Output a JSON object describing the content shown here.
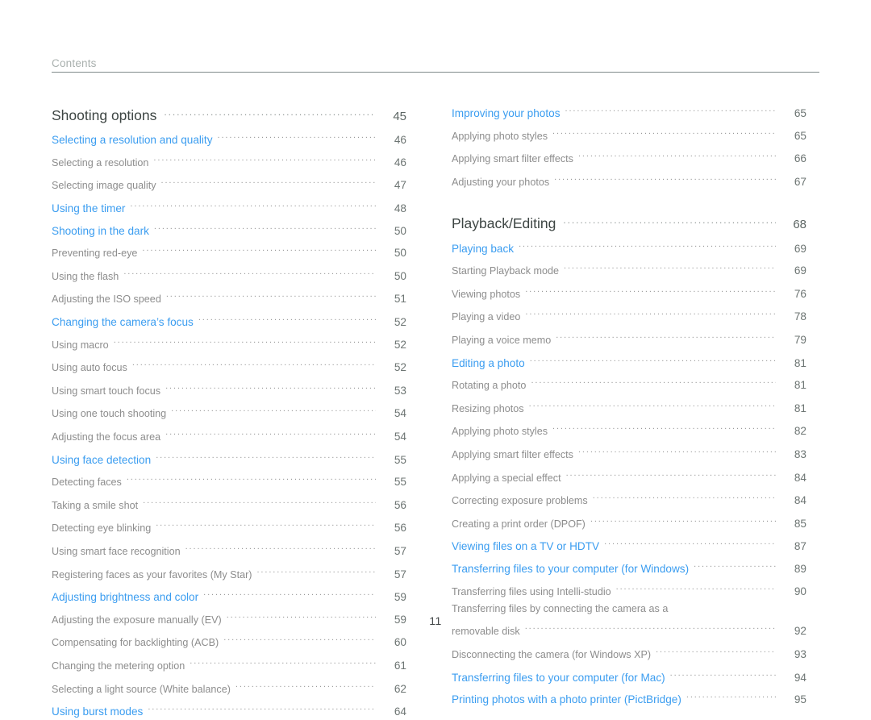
{
  "header": {
    "title": "Contents"
  },
  "colors": {
    "link_blue": "#3b9df0",
    "sub_gray": "#8d8d8d",
    "section_dark": "#3d4543",
    "header_gray": "#a9b0ae",
    "page_number": "#6d7573"
  },
  "footer": {
    "page_number": "11"
  },
  "left_column": [
    {
      "level": "section",
      "label": "Shooting options",
      "page": "45"
    },
    {
      "level": "1",
      "label": "Selecting a resolution and quality",
      "page": "46"
    },
    {
      "level": "2",
      "label": "Selecting a resolution",
      "page": "46"
    },
    {
      "level": "2",
      "label": "Selecting image quality",
      "page": "47"
    },
    {
      "level": "1",
      "label": "Using the timer",
      "page": "48"
    },
    {
      "level": "1",
      "label": "Shooting in the dark",
      "page": "50"
    },
    {
      "level": "2",
      "label": "Preventing red-eye",
      "page": "50"
    },
    {
      "level": "2",
      "label": "Using the flash",
      "page": "50"
    },
    {
      "level": "2",
      "label": "Adjusting the ISO speed",
      "page": "51"
    },
    {
      "level": "1",
      "label": "Changing the camera’s focus",
      "page": "52"
    },
    {
      "level": "2",
      "label": "Using macro",
      "page": "52"
    },
    {
      "level": "2",
      "label": "Using auto focus",
      "page": "52"
    },
    {
      "level": "2",
      "label": "Using smart touch focus",
      "page": "53"
    },
    {
      "level": "2",
      "label": "Using one touch shooting",
      "page": "54"
    },
    {
      "level": "2",
      "label": "Adjusting the focus area",
      "page": "54"
    },
    {
      "level": "1",
      "label": "Using face detection",
      "page": "55"
    },
    {
      "level": "2",
      "label": "Detecting faces",
      "page": "55"
    },
    {
      "level": "2",
      "label": "Taking a smile shot",
      "page": "56"
    },
    {
      "level": "2",
      "label": "Detecting eye blinking",
      "page": "56"
    },
    {
      "level": "2",
      "label": "Using smart face recognition",
      "page": "57"
    },
    {
      "level": "2",
      "label": "Registering faces as your favorites (My Star)",
      "page": "57"
    },
    {
      "level": "1",
      "label": "Adjusting brightness and color",
      "page": "59"
    },
    {
      "level": "2",
      "label": "Adjusting the exposure manually (EV)",
      "page": "59"
    },
    {
      "level": "2",
      "label": "Compensating for backlighting (ACB)",
      "page": "60"
    },
    {
      "level": "2",
      "label": "Changing the metering option",
      "page": "61"
    },
    {
      "level": "2",
      "label": "Selecting a light source (White balance)",
      "page": "62"
    },
    {
      "level": "1",
      "label": "Using burst modes",
      "page": "64"
    }
  ],
  "right_column": [
    {
      "level": "1",
      "label": "Improving your photos",
      "page": "65"
    },
    {
      "level": "2",
      "label": "Applying photo styles",
      "page": "65"
    },
    {
      "level": "2",
      "label": "Applying smart filter effects",
      "page": "66"
    },
    {
      "level": "2",
      "label": "Adjusting your photos",
      "page": "67"
    },
    {
      "level": "gap"
    },
    {
      "level": "section",
      "label": "Playback/Editing",
      "page": "68"
    },
    {
      "level": "1",
      "label": "Playing back",
      "page": "69"
    },
    {
      "level": "2",
      "label": "Starting Playback mode",
      "page": "69"
    },
    {
      "level": "2",
      "label": "Viewing photos",
      "page": "76"
    },
    {
      "level": "2",
      "label": "Playing a video",
      "page": "78"
    },
    {
      "level": "2",
      "label": "Playing a voice memo",
      "page": "79"
    },
    {
      "level": "1",
      "label": "Editing a photo",
      "page": "81"
    },
    {
      "level": "2",
      "label": "Rotating a photo",
      "page": "81"
    },
    {
      "level": "2",
      "label": "Resizing photos",
      "page": "81"
    },
    {
      "level": "2",
      "label": "Applying photo styles",
      "page": "82"
    },
    {
      "level": "2",
      "label": "Applying smart filter effects",
      "page": "83"
    },
    {
      "level": "2",
      "label": "Applying a special effect",
      "page": "84"
    },
    {
      "level": "2",
      "label": "Correcting exposure problems",
      "page": "84"
    },
    {
      "level": "2",
      "label": "Creating a print order (DPOF)",
      "page": "85"
    },
    {
      "level": "1",
      "label": "Viewing files on a TV or HDTV",
      "page": "87"
    },
    {
      "level": "1",
      "label": "Transferring files to your computer (for Windows)",
      "page": "89"
    },
    {
      "level": "2",
      "label": "Transferring files using Intelli-studio",
      "page": "90"
    },
    {
      "level": "2",
      "label": "Transferring files by connecting the camera as a",
      "label2": "removable disk",
      "page": "92"
    },
    {
      "level": "2",
      "label": "Disconnecting the camera (for Windows XP)",
      "page": "93"
    },
    {
      "level": "1",
      "label": "Transferring files to your computer (for Mac)",
      "page": "94"
    },
    {
      "level": "1",
      "label": "Printing photos with a photo printer (PictBridge)",
      "page": "95"
    }
  ]
}
